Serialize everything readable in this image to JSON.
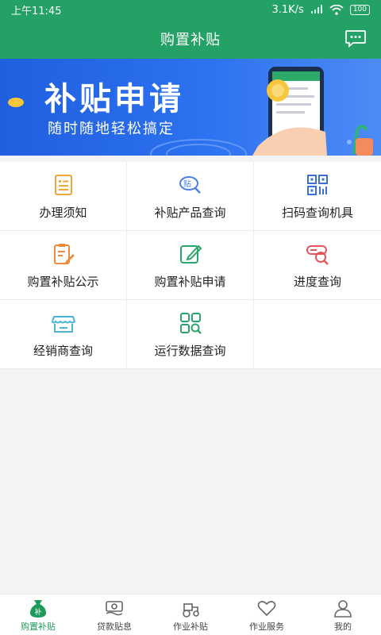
{
  "status": {
    "time": "上午11:45",
    "speed": "3.1K/s",
    "battery": "100"
  },
  "header": {
    "title": "购置补贴"
  },
  "banner": {
    "title": "补贴申请",
    "subtitle": "随时随地轻松搞定"
  },
  "grid": {
    "items": [
      {
        "label": "办理须知",
        "icon": "notice-doc-icon"
      },
      {
        "label": "补贴产品查询",
        "icon": "tag-search-icon"
      },
      {
        "label": "扫码查询机具",
        "icon": "qr-code-icon"
      },
      {
        "label": "购置补贴公示",
        "icon": "edit-clipboard-icon"
      },
      {
        "label": "购置补贴申请",
        "icon": "pencil-square-icon"
      },
      {
        "label": "进度查询",
        "icon": "progress-search-icon"
      },
      {
        "label": "经销商查询",
        "icon": "store-icon"
      },
      {
        "label": "运行数据查询",
        "icon": "grid-search-icon"
      }
    ]
  },
  "nav": {
    "items": [
      {
        "label": "购置补贴",
        "icon": "subsidy-bag-icon",
        "active": true
      },
      {
        "label": "贷款贴息",
        "icon": "money-icon",
        "active": false
      },
      {
        "label": "作业补贴",
        "icon": "tractor-icon",
        "active": false
      },
      {
        "label": "作业服务",
        "icon": "heart-icon",
        "active": false
      },
      {
        "label": "我的",
        "icon": "user-icon",
        "active": false
      }
    ]
  },
  "colors": {
    "brand": "#24a164",
    "active_nav": "#1e9a5c",
    "banner": "#2d72f0"
  }
}
